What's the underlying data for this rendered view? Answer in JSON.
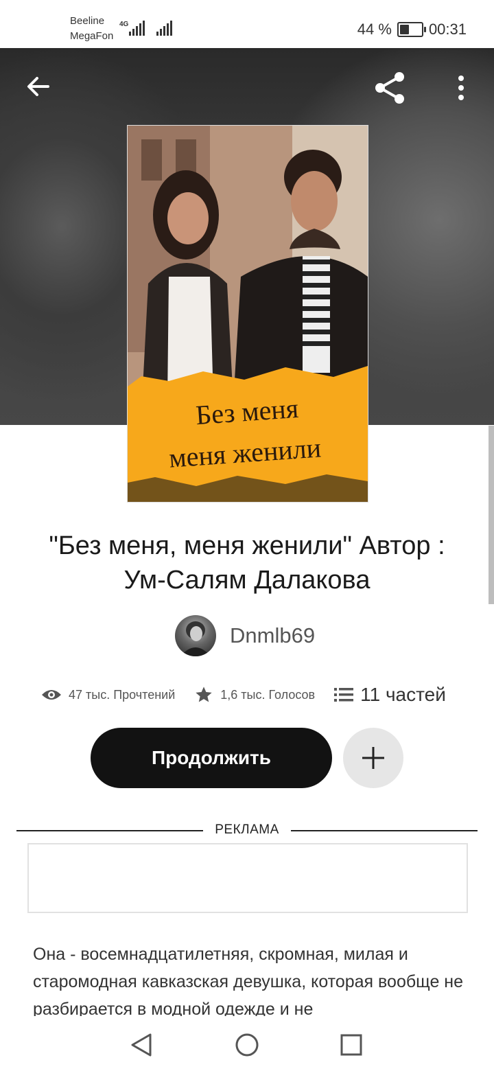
{
  "status_bar": {
    "carrier1": "Beeline",
    "carrier2": "MegaFon",
    "network": "4G",
    "battery_text": "44 %",
    "battery_level": 0.44,
    "time": "00:31"
  },
  "toolbar": {
    "back_icon": "arrow-left-icon",
    "share_icon": "share-icon",
    "more_icon": "more-vertical-icon"
  },
  "cover": {
    "line1": "Без меня",
    "line2": "меня женили"
  },
  "story": {
    "title": "\"Без меня, меня женили\"  Автор : Ум-Салям Далакова",
    "author": "Dnmlb69",
    "reads": "47 тыс. Прочтений",
    "votes": "1,6 тыс. Голосов",
    "parts": "11 частей",
    "continue_label": "Продолжить",
    "ad_label": "РЕКЛАМА",
    "description": "Она - восемнадцатилетняя, скромная, милая и старомодная кавказская девушка, которая вообще не разбирается в модной одежде и не"
  },
  "colors": {
    "primary_button": "#121212",
    "cover_banner": "#f7a81b"
  }
}
